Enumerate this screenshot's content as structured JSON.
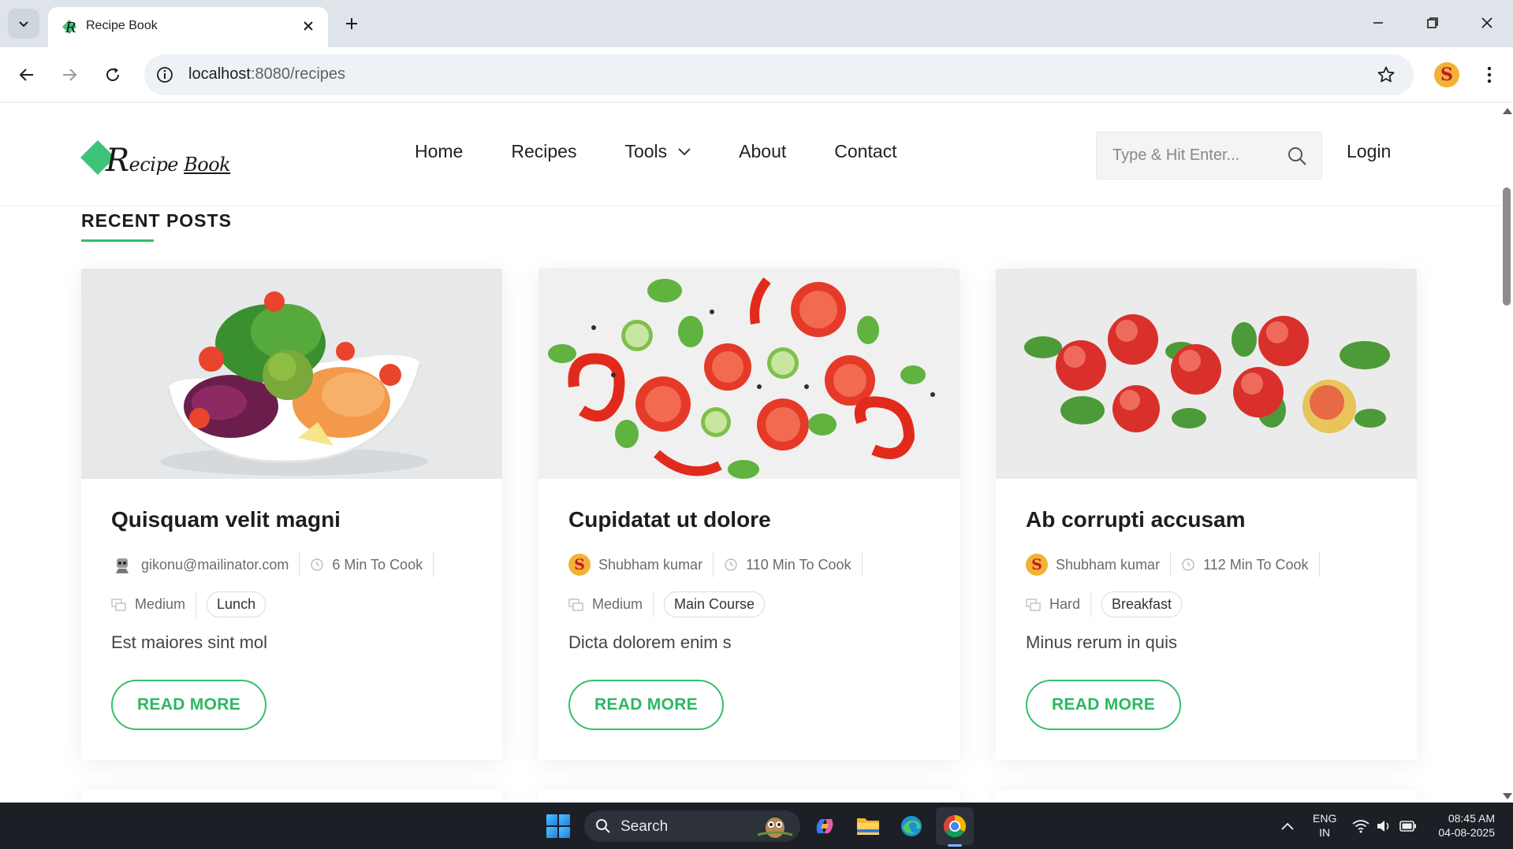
{
  "browser": {
    "tab_title": "Recipe Book",
    "url_host": "localhost",
    "url_path": ":8080/recipes",
    "profile_initial": "S"
  },
  "site": {
    "logo_text": "Recipe Book",
    "nav": [
      {
        "label": "Home"
      },
      {
        "label": "Recipes"
      },
      {
        "label": "Tools",
        "has_dropdown": true
      },
      {
        "label": "About"
      },
      {
        "label": "Contact"
      }
    ],
    "search_placeholder": "Type & Hit Enter...",
    "login_label": "Login",
    "accent_color": "#2ebd6a"
  },
  "recent_posts": {
    "heading": "RECENT POSTS",
    "cards": [
      {
        "image": "salad-bowl",
        "title": "Quisquam velit magni",
        "author": "gikonu@mailinator.com",
        "author_avatar": "robot-avatar",
        "cook_time": "6 Min To Cook",
        "difficulty": "Medium",
        "category": "Lunch",
        "excerpt": "Est maiores sint mol",
        "button": "READ MORE"
      },
      {
        "image": "tomatoes-peppers-cucumbers",
        "title": "Cupidatat ut dolore",
        "author": "Shubham kumar",
        "author_avatar": "S",
        "cook_time": "110 Min To Cook",
        "difficulty": "Medium",
        "category": "Main Course",
        "excerpt": "Dicta dolorem enim s",
        "button": "READ MORE"
      },
      {
        "image": "apples-leaves",
        "title": "Ab corrupti accusam",
        "author": "Shubham kumar",
        "author_avatar": "S",
        "cook_time": "112 Min To Cook",
        "difficulty": "Hard",
        "category": "Breakfast",
        "excerpt": "Minus rerum in quis",
        "button": "READ MORE"
      }
    ]
  },
  "taskbar": {
    "search_label": "Search",
    "lang_line1": "ENG",
    "lang_line2": "IN",
    "time": "08:45 AM",
    "date": "04-08-2025"
  }
}
